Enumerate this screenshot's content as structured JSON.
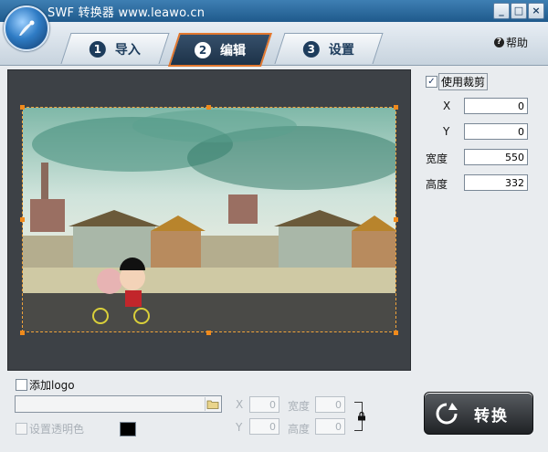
{
  "window": {
    "title": "SWF 转换器 www.leawo.cn",
    "buttons": {
      "minimize": "_",
      "maximize": "□",
      "close": "×"
    }
  },
  "tabs": [
    {
      "number": "1",
      "label": "导入",
      "active": false
    },
    {
      "number": "2",
      "label": "编辑",
      "active": true
    },
    {
      "number": "3",
      "label": "设置",
      "active": false
    }
  ],
  "help": {
    "label": "帮助",
    "icon": "question-circle-icon"
  },
  "crop": {
    "use_crop_label": "使用裁剪",
    "use_crop_checked": true,
    "x_label": "X",
    "x_value": "0",
    "y_label": "Y",
    "y_value": "0",
    "width_label": "宽度",
    "width_value": "550",
    "height_label": "高度",
    "height_value": "332"
  },
  "logo": {
    "add_logo_label": "添加logo",
    "add_logo_checked": false,
    "path_value": "",
    "x_label": "X",
    "x_value": "0",
    "y_label": "Y",
    "y_value": "0",
    "width_label": "宽度",
    "width_value": "0",
    "height_label": "高度",
    "height_value": "0",
    "transparent_label": "设置透明色",
    "transparent_checked": false,
    "color_swatch": "#000000"
  },
  "convert_button": {
    "label": "转换"
  },
  "colors": {
    "accent": "#e2772e",
    "title_bar": "#2a6aa0",
    "preview_bg": "#3d4146"
  }
}
